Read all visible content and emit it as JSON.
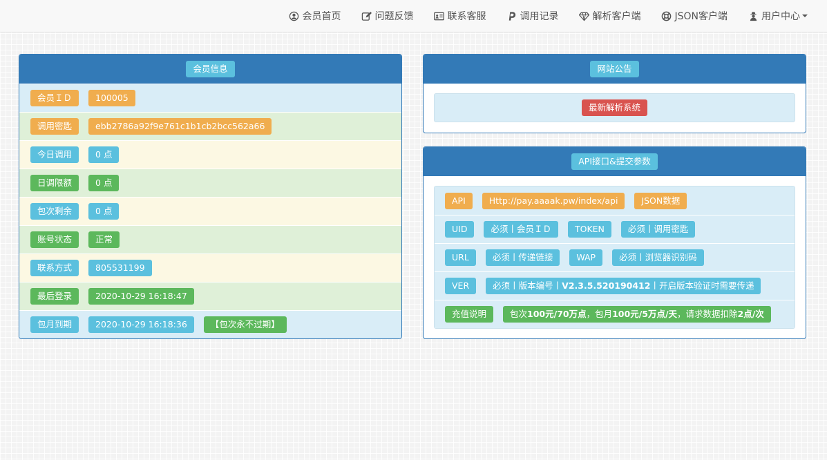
{
  "nav": [
    {
      "label": "会员首页",
      "icon": "user-circle-icon"
    },
    {
      "label": "问题反馈",
      "icon": "edit-icon"
    },
    {
      "label": "联系客服",
      "icon": "id-card-icon"
    },
    {
      "label": "调用记录",
      "icon": "paypal-icon"
    },
    {
      "label": "解析客户端",
      "icon": "diamond-icon"
    },
    {
      "label": "JSON客户端",
      "icon": "life-ring-icon"
    },
    {
      "label": "用户中心",
      "icon": "user-secret-icon"
    }
  ],
  "member": {
    "title": "会员信息",
    "rows": [
      {
        "label": "会员ＩＤ",
        "values": [
          "100005"
        ]
      },
      {
        "label": "调用密匙",
        "values": [
          "ebb2786a92f9e761c1b1cb2bcc562a66"
        ]
      },
      {
        "label": "今日调用",
        "values": [
          "0 点"
        ]
      },
      {
        "label": "日调限额",
        "values": [
          "0 点"
        ]
      },
      {
        "label": "包次剩余",
        "values": [
          "0 点"
        ]
      },
      {
        "label": "账号状态",
        "values": [
          "正常"
        ]
      },
      {
        "label": "联系方式",
        "values": [
          "805531199"
        ]
      },
      {
        "label": "最后登录",
        "values": [
          "2020-10-29 16:18:47"
        ]
      },
      {
        "label": "包月到期",
        "values": [
          "2020-10-29 16:18:36",
          "【包次永不过期】"
        ]
      }
    ]
  },
  "notice": {
    "title": "网站公告",
    "text": "最新解析系统"
  },
  "api": {
    "title": "API接口&提交参数",
    "rows": [
      {
        "items": [
          "API",
          "Http://pay.aaaak.pw/index/api",
          "JSON数据"
        ]
      },
      {
        "items": [
          "UID",
          "必须丨会员ＩＤ",
          "TOKEN",
          "必须丨调用密匙"
        ]
      },
      {
        "items": [
          "URL",
          "必须丨传递链接",
          "WAP",
          "必须丨浏览器识别码"
        ]
      },
      {
        "items": [
          "VER",
          "必须丨版本编号丨",
          "V2.3.5.520190412",
          "丨开启版本验证时需要传递"
        ]
      },
      {
        "items": [
          "充值说明",
          "包次",
          "100元/70万点",
          "，包月",
          "100元/5万点/天",
          "，请求数据扣除",
          "2点/次"
        ]
      }
    ]
  },
  "colors": {
    "primary": "#337ab7",
    "info": "#5bc0de",
    "warning": "#f0ad4e",
    "success": "#5cb85c",
    "danger": "#d9534f"
  }
}
